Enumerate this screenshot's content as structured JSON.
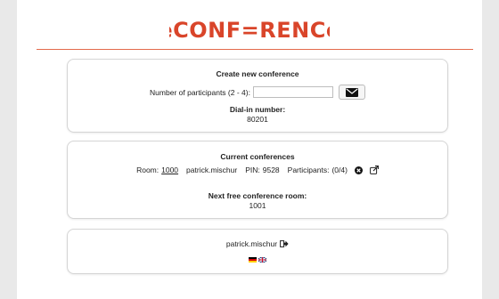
{
  "brand": {
    "logo_text": "eCONFeRENCe"
  },
  "create": {
    "title": "Create new conference",
    "participants_label": "Number of participants (2 - 4):",
    "participants_value": "",
    "dialin_label": "Dial-in number:",
    "dialin_number": "80201"
  },
  "current": {
    "title": "Current conferences",
    "room_label": "Room:",
    "room_number": "1000",
    "owner": "patrick.mischur",
    "pin_label": "PIN:",
    "pin_value": "9528",
    "participants_label": "Participants:",
    "participants_value": "(0/4)",
    "next_label": "Next free conference room:",
    "next_room": "1001"
  },
  "user": {
    "username": "patrick.mischur"
  },
  "colors": {
    "brand": "#d9452a",
    "rule": "#e36a4c"
  }
}
